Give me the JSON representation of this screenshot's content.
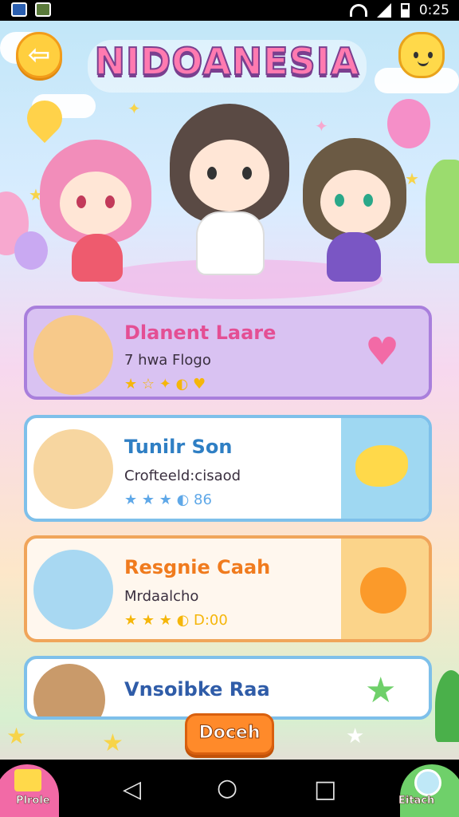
{
  "status_bar": {
    "time": "0:25"
  },
  "header": {
    "title": "NIDOANESIA",
    "back_icon": "arrow-left-icon"
  },
  "cards": [
    {
      "title": "Dlanent Laare",
      "subtitle": "7 hwa Flogo",
      "rating_text": "★ ☆ ✦ ◐ ♥",
      "color": "#a97fdc",
      "bg": "#d9c2f2",
      "title_color": "#e44f94",
      "right_icon": "heart-icon"
    },
    {
      "title": "Tunilr Son",
      "subtitle": "Crofteeld:cisaod",
      "rating_text": "★ ★ ★ ◐ 86",
      "color": "#7ec0ea",
      "bg": "#ffffff",
      "title_color": "#2f7fc4",
      "right_icon": "fish-icon"
    },
    {
      "title": "Resgnie Caah",
      "subtitle": "Mrdaalcho",
      "rating_text": "★ ★ ★ ◐ D:00",
      "color": "#f0a55a",
      "bg": "#fff7ee",
      "title_color": "#f07b1e",
      "right_icon": "smiley-sun-icon"
    },
    {
      "title": "Vnsoibke Raa",
      "color": "#7ec0ea",
      "bg": "#ffffff",
      "title_color": "#2f5ca8",
      "right_icon": "star-icon"
    }
  ],
  "cta": {
    "label": "Doceh"
  },
  "bottom": {
    "left_label": "Plrole",
    "right_label": "Eitach"
  }
}
